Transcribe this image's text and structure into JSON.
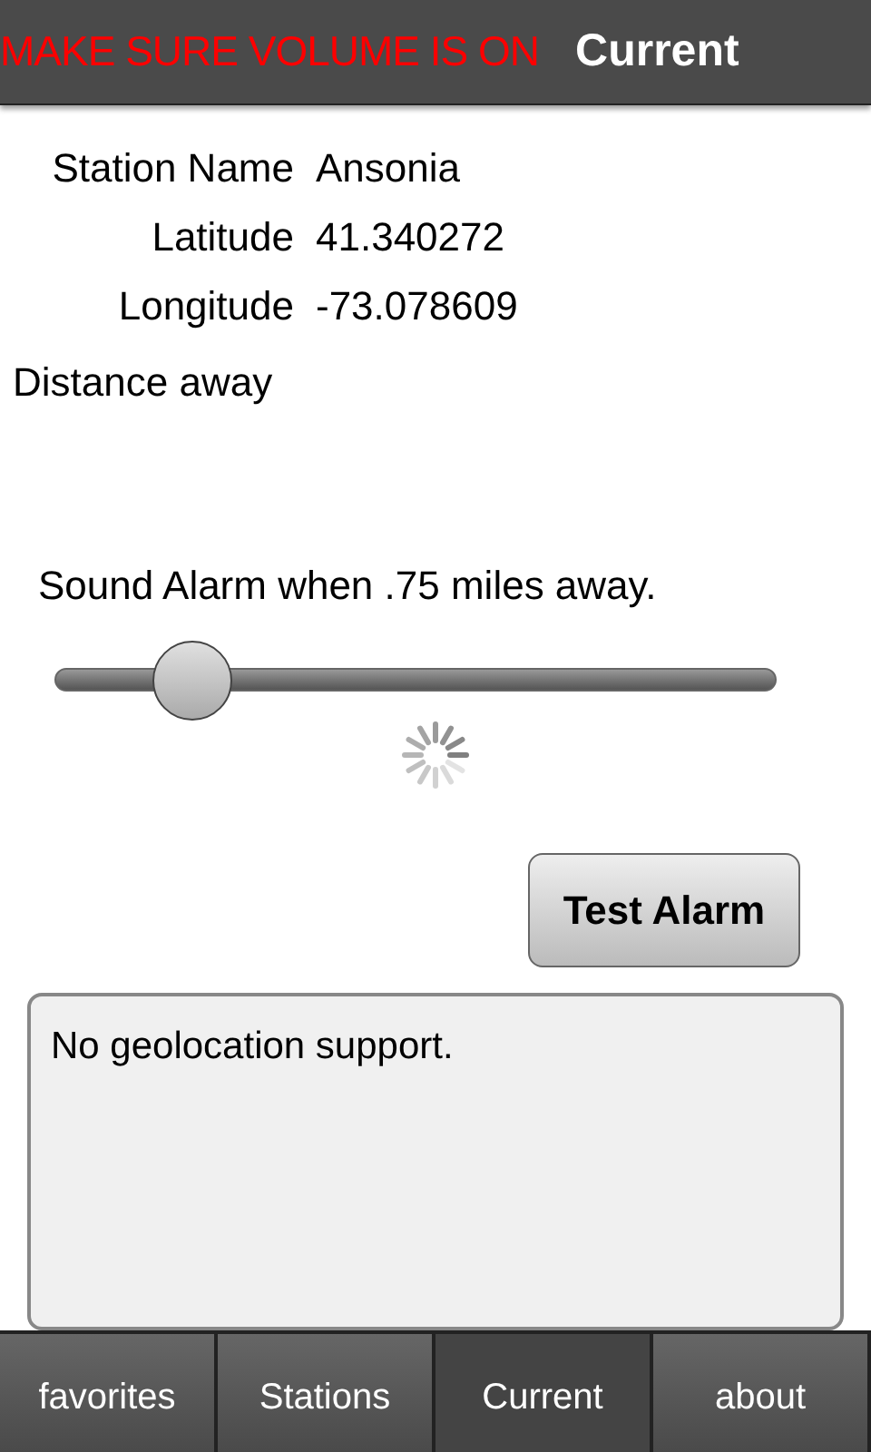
{
  "header": {
    "warning": "MAKE SURE VOLUME IS ON",
    "title": "Current"
  },
  "fields": [
    {
      "label": "Station Name",
      "value": "Ansonia"
    },
    {
      "label": "Latitude",
      "value": "41.340272"
    },
    {
      "label": "Longitude",
      "value": "-73.078609"
    }
  ],
  "distance_label": "Distance away",
  "alarm": {
    "label": "Sound Alarm when .75 miles away.",
    "level": 0.19
  },
  "test_button": "Test Alarm",
  "message": "No geolocation support.",
  "tabs": [
    {
      "label": "favorites",
      "selected": false
    },
    {
      "label": "Stations",
      "selected": false
    },
    {
      "label": "Current",
      "selected": true
    },
    {
      "label": "about",
      "selected": false
    }
  ]
}
